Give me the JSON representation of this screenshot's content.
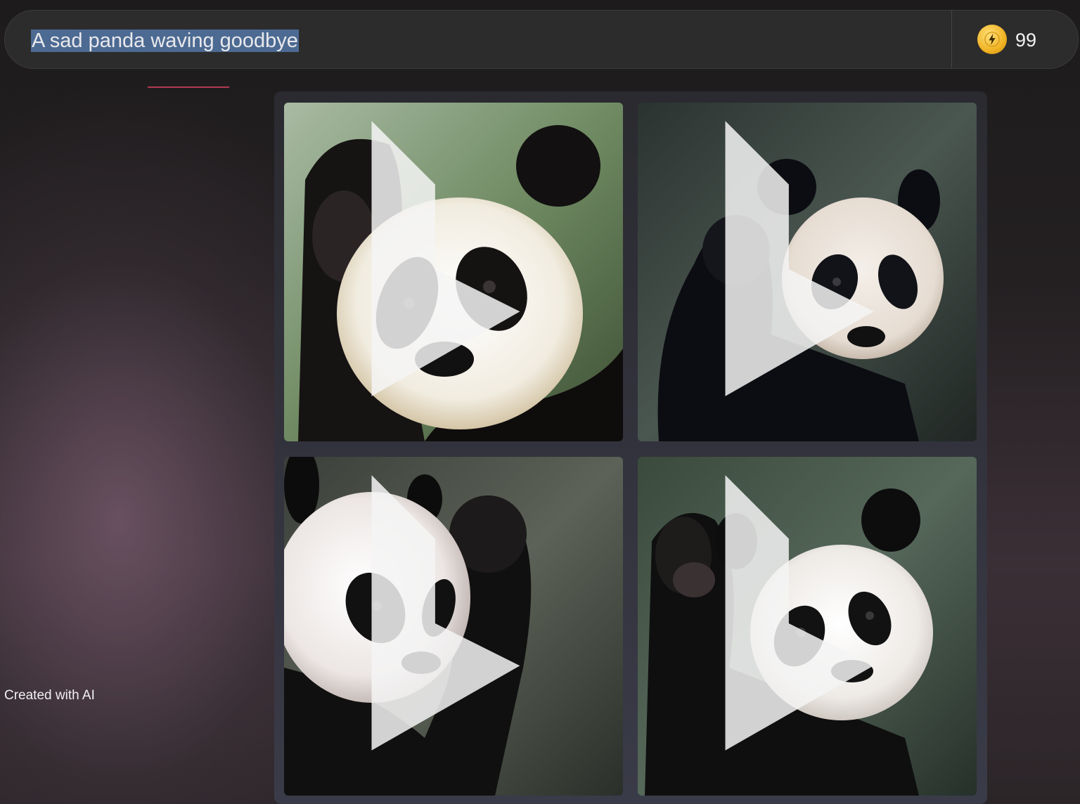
{
  "search": {
    "prompt_text": "A sad panda waving goodbye"
  },
  "boost": {
    "icon": "lightning-coin-icon",
    "count": "99",
    "color": "#f0b323"
  },
  "images": [
    {
      "name": "panda-image-1",
      "alt": "A sad panda waving goodbye"
    },
    {
      "name": "panda-image-2",
      "alt": "A sad panda waving goodbye"
    },
    {
      "name": "panda-image-3",
      "alt": "A sad panda waving goodbye"
    },
    {
      "name": "panda-image-4",
      "alt": "A sad panda waving goodbye"
    }
  ],
  "footer": {
    "created_label": "Created with AI"
  },
  "colors": {
    "selection": "#4c6a92",
    "accent_underline": "#b23a52"
  }
}
